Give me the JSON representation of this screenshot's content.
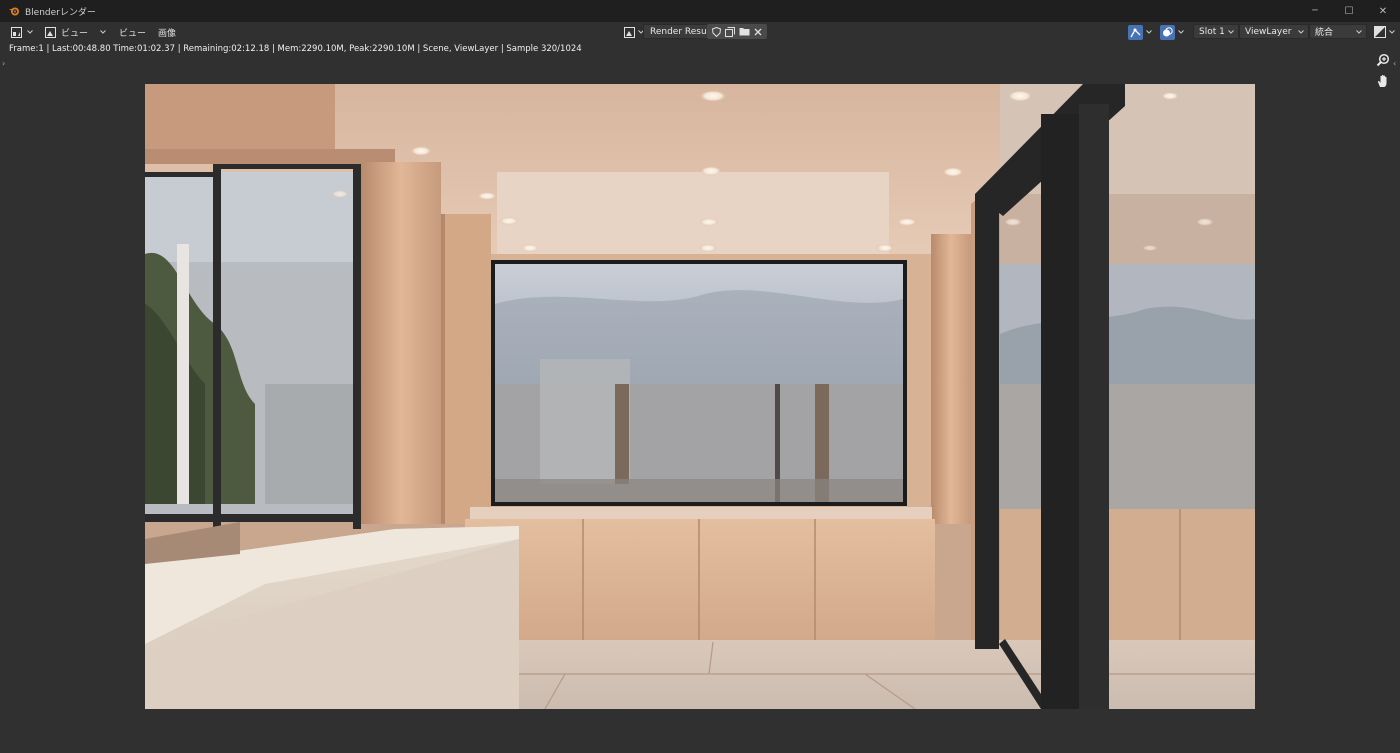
{
  "window": {
    "title": "Blenderレンダー",
    "controls": {
      "minimize": "─",
      "maximize": "☐",
      "close": "✕"
    }
  },
  "header": {
    "menus": {
      "view_menu": "ビュー",
      "view": "ビュー",
      "image": "画像"
    },
    "image_name": "Render Result",
    "slot": "Slot 1",
    "view_layer": "ViewLayer",
    "pass": "統合"
  },
  "status": {
    "text": "Frame:1 | Last:00:48.80 Time:01:02.37 | Remaining:02:12.18 | Mem:2290.10M, Peak:2290.10M | Scene, ViewLayer | Sample 320/1024"
  },
  "icons": {
    "app": "blender-logo-icon",
    "editor_type": "image-editor-icon",
    "mode": "view-mode-icon",
    "image_browse": "image-browse-icon",
    "fake_user": "shield-icon",
    "new_image": "duplicate-icon",
    "open_image": "folder-icon",
    "unlink": "close-icon",
    "gizmo": "gizmo-icon",
    "overlay": "overlay-icon",
    "display_channels": "display-channels-icon",
    "zoom": "zoom-icon",
    "pan": "hand-icon"
  },
  "colors": {
    "window_bg": "#303030",
    "titlebar_bg": "#1f1f1f",
    "accent_blue": "#4772b3",
    "orange": "#e87d0d"
  }
}
